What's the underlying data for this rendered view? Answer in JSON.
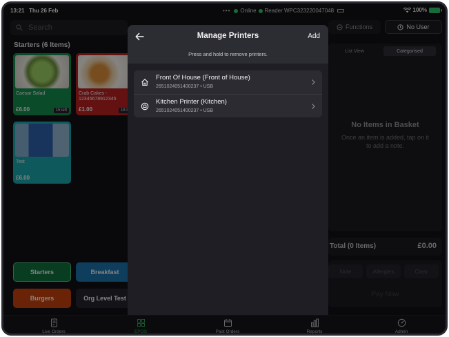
{
  "status_bar": {
    "time": "13:21",
    "date": "Thu 26 Feb",
    "online": "Online",
    "reader": "Reader WPC323220047048",
    "battery": "100%"
  },
  "left_panel": {
    "search_placeholder": "Search",
    "section_title": "Starters (6 Items)",
    "products": [
      {
        "name": "Caesar Salad",
        "price": "£6.00",
        "stock": "15 left",
        "color": "#138a4c"
      },
      {
        "name": "Crab Cakes -\n12345678912345",
        "price": "£1.00",
        "stock": "18 le",
        "color": "#b51f1f"
      },
      {
        "name": "Test",
        "price": "£6.00",
        "stock": "",
        "color": "#1aa3a6"
      }
    ],
    "categories": [
      {
        "label": "Starters",
        "color": "#0f6f3c"
      },
      {
        "label": "Breakfast",
        "color": "#1d6fa8"
      },
      {
        "label": "Burgers",
        "color": "#c2410c"
      },
      {
        "label": "Org Level Test",
        "color": "#26262c"
      }
    ]
  },
  "right_panel": {
    "functions_label": "Functions",
    "no_user_label": "No User",
    "view_options": [
      "List View",
      "Categorised"
    ],
    "active_view": "Categorised",
    "empty_title": "No Items in Basket",
    "empty_subtitle": "Once an item is added, tap on it to add a note.",
    "total_label": "Total (0 Items)",
    "total_value": "£0.00",
    "actions": [
      "Note",
      "Allergies",
      "Clear"
    ],
    "pay_now": "Pay Now"
  },
  "modal": {
    "title": "Manage Printers",
    "add_label": "Add",
    "hint": "Press and hold to remove printers.",
    "printers": [
      {
        "name": "Front Of House (Front of House)",
        "meta": "2651024051400237 • USB",
        "icon": "home-icon"
      },
      {
        "name": "Kitchen Printer (Kitchen)",
        "meta": "2651024051400237 • USB",
        "icon": "chef-icon"
      }
    ]
  },
  "tabs": [
    {
      "label": "Live Orders",
      "icon": "receipt-icon"
    },
    {
      "label": "EPOS",
      "icon": "grid-icon",
      "active": true
    },
    {
      "label": "Past Orders",
      "icon": "calendar-icon"
    },
    {
      "label": "Reports",
      "icon": "bar-chart-icon"
    },
    {
      "label": "Admin",
      "icon": "gauge-icon"
    }
  ]
}
